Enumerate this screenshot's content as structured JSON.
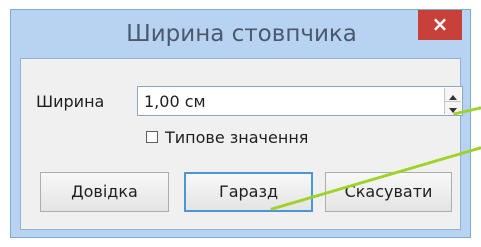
{
  "window": {
    "title": "Ширина стовпчика",
    "close_label": "×"
  },
  "field": {
    "label": "Ширина",
    "value": "1,00 см"
  },
  "checkbox": {
    "label": "Типове значення",
    "checked": false
  },
  "buttons": {
    "help": "Довідка",
    "ok": "Гаразд",
    "cancel": "Скасувати"
  },
  "colors": {
    "frame": "#b8d3f1",
    "close": "#c8403a",
    "focus": "#4c95d8",
    "annotation": "#9fd226"
  }
}
